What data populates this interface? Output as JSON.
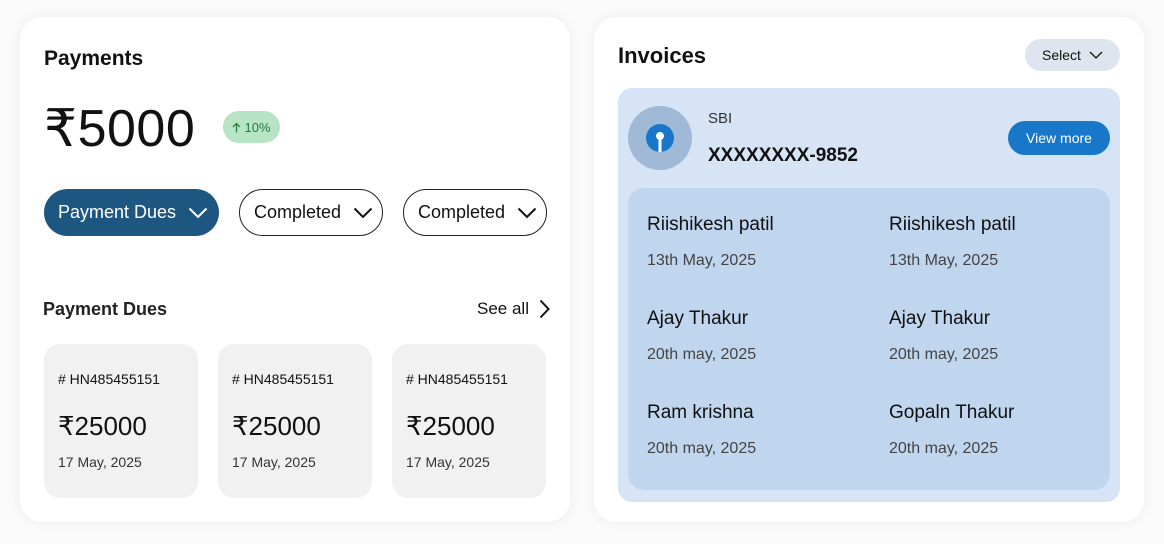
{
  "payments": {
    "title": "Payments",
    "amount": "₹5000",
    "growth": "10%",
    "filters": [
      {
        "label": "Payment Dues"
      },
      {
        "label": "Completed"
      },
      {
        "label": "Completed"
      }
    ],
    "dues_heading": "Payment Dues",
    "see_all": "See all",
    "dues": [
      {
        "id": "# HN485455151",
        "amount": "₹25000",
        "date": "17 May, 2025"
      },
      {
        "id": "# HN485455151",
        "amount": "₹25000",
        "date": "17 May, 2025"
      },
      {
        "id": "# HN485455151",
        "amount": "₹25000",
        "date": "17 May, 2025"
      }
    ]
  },
  "invoices": {
    "title": "Invoices",
    "select_label": "Select",
    "bank": {
      "name": "SBI",
      "account": "XXXXXXXX-9852",
      "view_more": "View more"
    },
    "transactions": [
      {
        "name": "Riishikesh patil",
        "date": "13th May, 2025"
      },
      {
        "name": "Riishikesh patil",
        "date": "13th May, 2025"
      },
      {
        "name": "Ajay Thakur",
        "date": "20th may, 2025"
      },
      {
        "name": "Ajay Thakur",
        "date": "20th may, 2025"
      },
      {
        "name": "Ram krishna",
        "date": "20th may, 2025"
      },
      {
        "name": "Gopaln Thakur",
        "date": "20th may, 2025"
      }
    ]
  },
  "icons": {
    "growth": "arrow-up-icon",
    "dropdown": "chevron-down-icon",
    "see_all": "chevron-right-icon",
    "bank": "sbi-logo-icon"
  },
  "colors": {
    "primary": "#1e5682",
    "accent": "#1877c9",
    "growth_bg": "#b7e4c4",
    "growth_text": "#237a3c",
    "bank_panel": "#d6e4f5",
    "txn_panel": "#c0d5ee"
  }
}
